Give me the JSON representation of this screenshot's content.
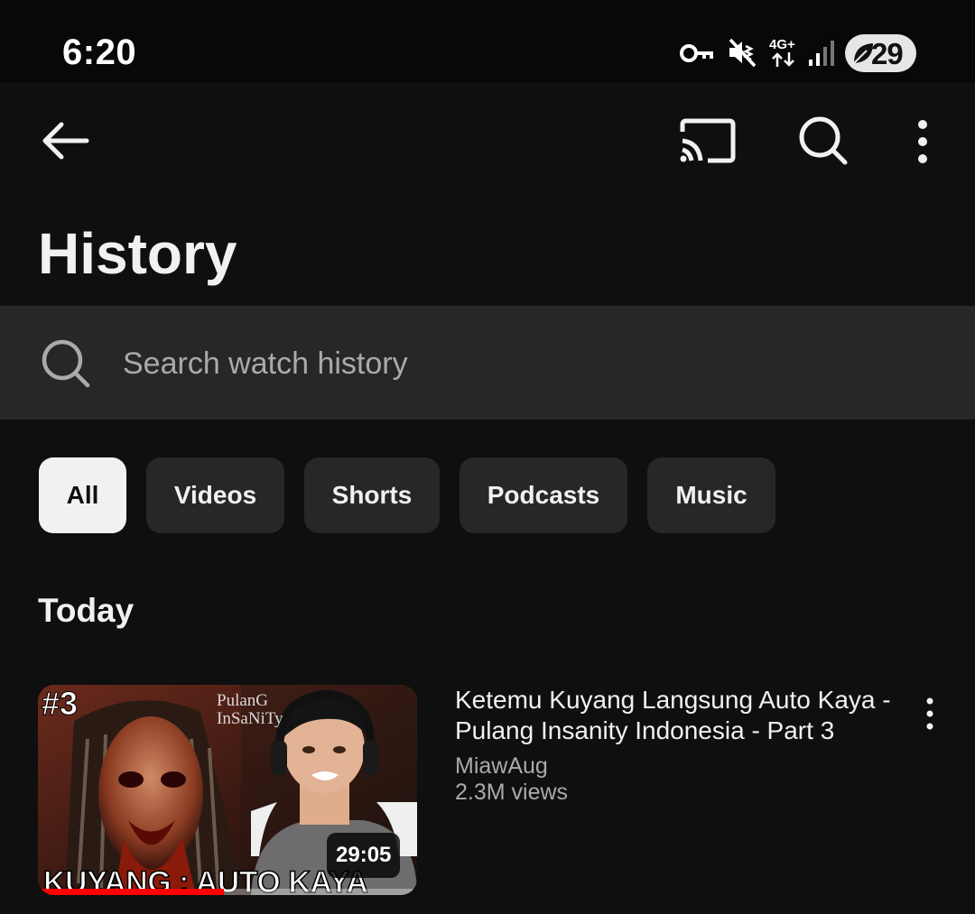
{
  "status_bar": {
    "time": "6:20",
    "network": "4G+",
    "battery": "29",
    "icons": [
      "vpn-key-icon",
      "vibrate-mute-icon",
      "mobile-data-icon",
      "signal-icon",
      "battery-saver-icon"
    ]
  },
  "app_bar": {
    "icons": [
      "back-arrow-icon",
      "cast-icon",
      "search-icon",
      "more-vert-icon"
    ]
  },
  "page": {
    "title": "History"
  },
  "search": {
    "placeholder": "Search watch history"
  },
  "filters": {
    "selected": "All",
    "chips": [
      "All",
      "Videos",
      "Shorts",
      "Podcasts",
      "Music"
    ]
  },
  "sections": [
    {
      "heading": "Today",
      "items": [
        {
          "title": "Ketemu Kuyang Langsung Auto Kaya - Pulang Insanity Indonesia - Part 3",
          "channel": "MiawAug",
          "views": "2.3M views",
          "duration": "29:05",
          "watch_progress": 0.49,
          "thumbnail": {
            "number_badge": "#3",
            "game_logo": "PulanG InSaNiTy",
            "caption": "KUYANG : AUTO KAYA"
          }
        }
      ]
    }
  ],
  "colors": {
    "background": "#0f0f0f",
    "surface": "#272727",
    "text_primary": "#f1f1f1",
    "text_secondary": "#aaaaaa",
    "progress": "#ff0000"
  }
}
